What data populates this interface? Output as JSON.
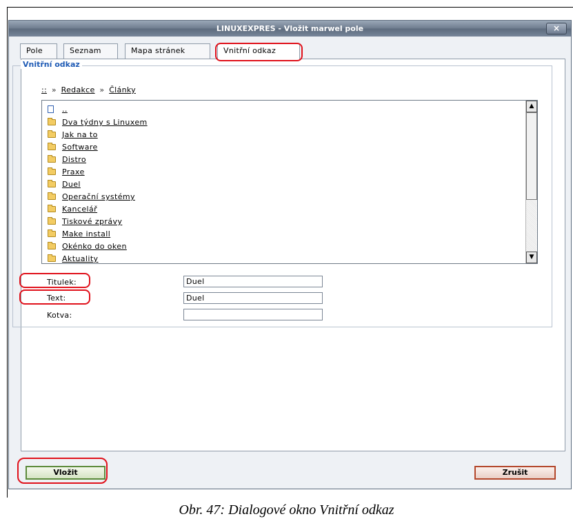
{
  "dialog": {
    "title": "LINUXEXPRES - Vložit marwel pole",
    "close_symbol": "×"
  },
  "tabs": [
    {
      "label": "Pole"
    },
    {
      "label": "Seznam"
    },
    {
      "label": "Mapa stránek"
    },
    {
      "label": "Vnitřní odkaz",
      "active": true
    }
  ],
  "fieldset": {
    "legend": "Vnitřní odkaz"
  },
  "breadcrumb": {
    "root": "::",
    "separator": "»",
    "items": [
      "Redakce",
      "Články"
    ]
  },
  "file_list": {
    "items": [
      {
        "label": "..",
        "icon": "document-icon"
      },
      {
        "label": "Dva týdny s Linuxem",
        "icon": "folder-icon"
      },
      {
        "label": "Jak na to",
        "icon": "folder-icon"
      },
      {
        "label": "Software",
        "icon": "folder-icon"
      },
      {
        "label": "Distro",
        "icon": "folder-icon"
      },
      {
        "label": "Praxe",
        "icon": "folder-icon"
      },
      {
        "label": "Duel",
        "icon": "folder-icon"
      },
      {
        "label": "Operační systémy",
        "icon": "folder-icon"
      },
      {
        "label": "Kancelář",
        "icon": "folder-icon"
      },
      {
        "label": "Tiskové zprávy",
        "icon": "folder-icon"
      },
      {
        "label": "Make install",
        "icon": "folder-icon"
      },
      {
        "label": "Okénko do oken",
        "icon": "folder-icon"
      },
      {
        "label": "Aktuality",
        "icon": "folder-icon"
      }
    ]
  },
  "form": {
    "titulek_label": "Titulek:",
    "titulek_value": "Duel",
    "text_label": "Text:",
    "text_value": "Duel",
    "kotva_label": "Kotva:",
    "kotva_value": ""
  },
  "buttons": {
    "insert": "Vložit",
    "cancel": "Zrušit"
  },
  "caption": "Obr. 47: Dialogové okno Vnitřní odkaz",
  "colors": {
    "highlight": "#e0101a",
    "legend": "#1f5bb5",
    "title_bar": "#6e7c8e"
  }
}
